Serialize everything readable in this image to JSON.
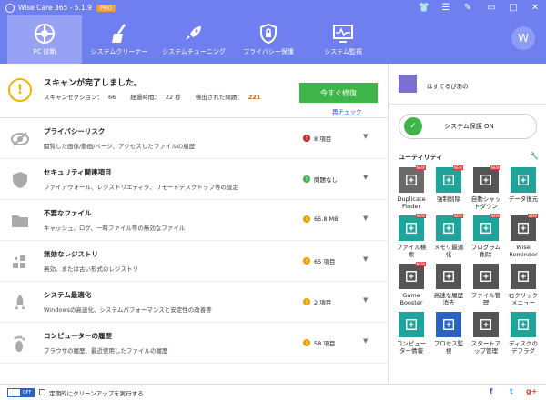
{
  "titlebar": {
    "title": "Wise Care 365 - 5.1.9",
    "badge": "PRO"
  },
  "nav": {
    "tabs": [
      {
        "label": "PC 診断",
        "icon": "pc-checkup-icon"
      },
      {
        "label": "システムクリーナー",
        "icon": "broom-icon"
      },
      {
        "label": "システムチューニング",
        "icon": "rocket-icon"
      },
      {
        "label": "プライバシー保護",
        "icon": "lock-icon"
      },
      {
        "label": "システム監視",
        "icon": "monitor-pulse-icon"
      }
    ],
    "avatar_letter": "W"
  },
  "scan": {
    "title": "スキャンが完了しました。",
    "section_label": "スキャンセクション：",
    "section_value": "66",
    "time_label": "経過時間：",
    "time_value": "22 秒",
    "problems_label": "検出された問題：",
    "problems_value": "221",
    "fix_button": "今すぐ修復",
    "recheck": "再チェック"
  },
  "rows": [
    {
      "title": "プライバシーリスク",
      "desc": "閲覧した画像/動画/ページ、アクセスしたファイルの履歴",
      "status": "8 項目",
      "status_color": "#c62a2a",
      "icon": "eye-slash-icon"
    },
    {
      "title": "セキュリティ関連項目",
      "desc": "ファイアウォール、レジストリエディタ、リモートデスクトップ等の設定",
      "status": "問題なし",
      "status_color": "#3fb549",
      "icon": "shield-icon"
    },
    {
      "title": "不要なファイル",
      "desc": "キャッシュ、ログ、一時ファイル等の無効なファイル",
      "status": "65.8 MB",
      "status_color": "#f0a000",
      "icon": "folder-icon"
    },
    {
      "title": "無効なレジストリ",
      "desc": "無効、または古い形式のレジストリ",
      "status": "65 項目",
      "status_color": "#f0a000",
      "icon": "registry-blocks-icon"
    },
    {
      "title": "システム最適化",
      "desc": "Windowsの高速化、システムパフォーマンスと安定性の改善等",
      "status": "2 項目",
      "status_color": "#f0a000",
      "icon": "rocket-icon"
    },
    {
      "title": "コンピューターの履歴",
      "desc": "ブラウザの履歴、最近使用したファイルの履歴",
      "status": "58 項目",
      "status_color": "#f0a000",
      "icon": "footprint-icon"
    }
  ],
  "side": {
    "username": "はすてるぴあの",
    "protect": "システム保護 ON",
    "utilities_title": "ユーティリティ",
    "utilities": [
      {
        "label": "Duplicate Finder",
        "color": "#6a6a6a",
        "icon": "duplicate-finder-icon",
        "new": true
      },
      {
        "label": "強制削除",
        "color": "#1fa39a",
        "icon": "trash-icon",
        "new": true
      },
      {
        "label": "自動シャットダウン",
        "color": "#555555",
        "icon": "power-icon",
        "new": true
      },
      {
        "label": "データ復元",
        "color": "#1fa39a",
        "icon": "data-recovery-icon",
        "new": false
      },
      {
        "label": "ファイル検索",
        "color": "#1fa39a",
        "icon": "file-search-icon",
        "new": true
      },
      {
        "label": "メモリ最適化",
        "color": "#1fa39a",
        "icon": "memory-icon",
        "new": true
      },
      {
        "label": "プログラム削除",
        "color": "#1fa39a",
        "icon": "uninstall-icon",
        "new": true
      },
      {
        "label": "Wise Reminder",
        "color": "#555555",
        "icon": "calendar-check-icon",
        "new": true
      },
      {
        "label": "Game Booster",
        "color": "#555555",
        "icon": "rocket-icon",
        "new": true
      },
      {
        "label": "高速な履歴消去",
        "color": "#555555",
        "icon": "history-eraser-icon",
        "new": false
      },
      {
        "label": "ファイル管理",
        "color": "#555555",
        "icon": "file-manager-icon",
        "new": false
      },
      {
        "label": "右クリックメニュー",
        "color": "#555555",
        "icon": "context-menu-icon",
        "new": false
      },
      {
        "label": "コンピューター情報",
        "color": "#1fa39a",
        "icon": "computer-info-icon",
        "new": false
      },
      {
        "label": "プロセス監視",
        "color": "#2b62c6",
        "icon": "process-monitor-icon",
        "new": false
      },
      {
        "label": "スタートアップ管理",
        "color": "#555555",
        "icon": "startup-icon",
        "new": false
      },
      {
        "label": "ディスクのデフラグ",
        "color": "#1fa39a",
        "icon": "disk-defrag-icon",
        "new": false
      }
    ]
  },
  "footer": {
    "toggle": "OFF",
    "text": "定期的にクリーンアップを実行する",
    "social": [
      "f",
      "t",
      "g+"
    ]
  }
}
